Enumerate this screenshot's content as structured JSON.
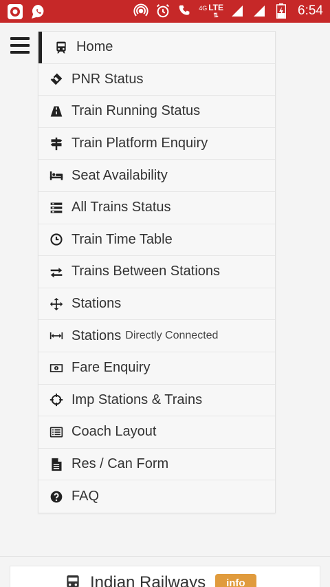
{
  "statusbar": {
    "network_4g": "4G",
    "network_lte": "LTE",
    "time": "6:54"
  },
  "menu": {
    "items": [
      {
        "label": "Home",
        "icon": "train-icon"
      },
      {
        "label": "PNR Status",
        "icon": "ticket-icon"
      },
      {
        "label": "Train Running Status",
        "icon": "road-icon"
      },
      {
        "label": "Train Platform Enquiry",
        "icon": "signpost-icon"
      },
      {
        "label": "Seat Availability",
        "icon": "bed-icon"
      },
      {
        "label": "All Trains Status",
        "icon": "list-bars-icon"
      },
      {
        "label": "Train Time Table",
        "icon": "clock-icon"
      },
      {
        "label": "Trains Between Stations",
        "icon": "exchange-arrows-icon"
      },
      {
        "label": "Stations",
        "icon": "move-arrows-icon"
      },
      {
        "label": "Stations",
        "sub": "Directly Connected",
        "icon": "horizontal-span-icon"
      },
      {
        "label": "Fare Enquiry",
        "icon": "money-icon"
      },
      {
        "label": "Imp Stations & Trains",
        "icon": "crosshairs-icon"
      },
      {
        "label": "Coach Layout",
        "icon": "list-alt-icon"
      },
      {
        "label": "Res / Can Form",
        "icon": "file-text-icon"
      },
      {
        "label": "FAQ",
        "icon": "question-circle-icon"
      }
    ]
  },
  "bottom_card": {
    "title": "Indian Railways",
    "badge": "info"
  },
  "colors": {
    "statusbar_bg": "#c62828",
    "badge_bg": "#e09b3d",
    "menu_bg": "#f7f7f7"
  }
}
